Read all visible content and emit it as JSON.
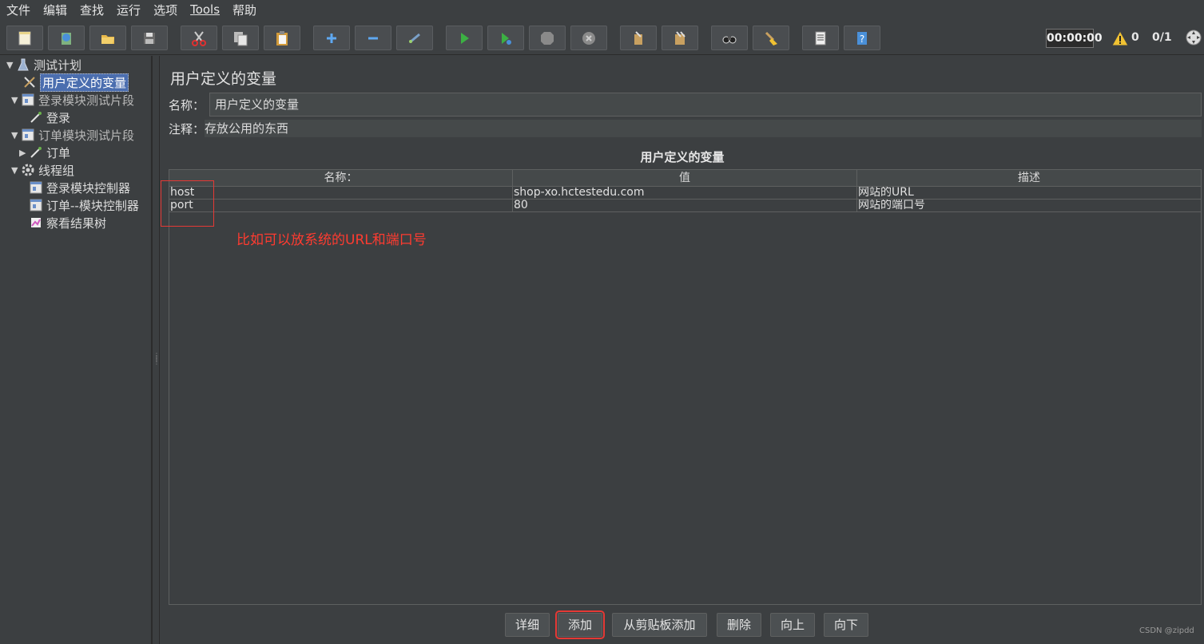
{
  "menu": [
    "文件",
    "编辑",
    "查找",
    "运行",
    "选项",
    "Tools",
    "帮助"
  ],
  "toolbar": {
    "timer": "00:00:00",
    "warnings": "0",
    "threads": "0/1",
    "buttons": [
      "new-icon",
      "templates-icon",
      "open-icon",
      "save-icon",
      "cut-icon",
      "copy-icon",
      "paste-icon",
      "expand-icon",
      "collapse-icon",
      "toggle-icon",
      "start-icon",
      "start-no-pause-icon",
      "stop-icon",
      "shutdown-icon",
      "clear-icon",
      "clear-all-icon",
      "search-icon",
      "reset-search-icon",
      "function-helper-icon",
      "help-icon"
    ]
  },
  "tree": {
    "items": [
      {
        "label": "测试计划",
        "icon": "test-plan-icon",
        "expanded": true
      },
      {
        "label": "用户定义的变量",
        "icon": "wrench-icon",
        "selected": true
      },
      {
        "label": "登录模块测试片段",
        "icon": "fragment-icon",
        "expanded": true
      },
      {
        "label": "登录",
        "icon": "sampler-icon"
      },
      {
        "label": "订单模块测试片段",
        "icon": "fragment-icon",
        "expanded": true
      },
      {
        "label": "订单",
        "icon": "sampler-icon",
        "expanded": false
      },
      {
        "label": "线程组",
        "icon": "thread-group-icon",
        "expanded": true
      },
      {
        "label": "登录模块控制器",
        "icon": "controller-icon"
      },
      {
        "label": "订单--模块控制器",
        "icon": "controller-icon"
      },
      {
        "label": "察看结果树",
        "icon": "results-tree-icon"
      }
    ]
  },
  "panel": {
    "title": "用户定义的变量",
    "name_label": "名称：",
    "name_value": "用户定义的变量",
    "comment_label": "注释：",
    "comment_value": "存放公用的东西",
    "table_title": "用户定义的变量"
  },
  "table": {
    "headers": [
      "名称：",
      "值",
      "描述"
    ],
    "rows": [
      [
        "host",
        "shop-xo.hctestedu.com",
        "网站的URL"
      ],
      [
        "port",
        "80",
        "网站的端口号"
      ]
    ]
  },
  "annotation": "比如可以放系统的URL和端口号",
  "buttons": [
    "详细",
    "添加",
    "从剪贴板添加",
    "删除",
    "向上",
    "向下"
  ],
  "watermark": "CSDN @zipdd",
  "colors": {
    "background": "#3c3f41",
    "selection": "#4b6eaf",
    "annotation": "#ff3b30",
    "highlight_box": "#e53935"
  }
}
